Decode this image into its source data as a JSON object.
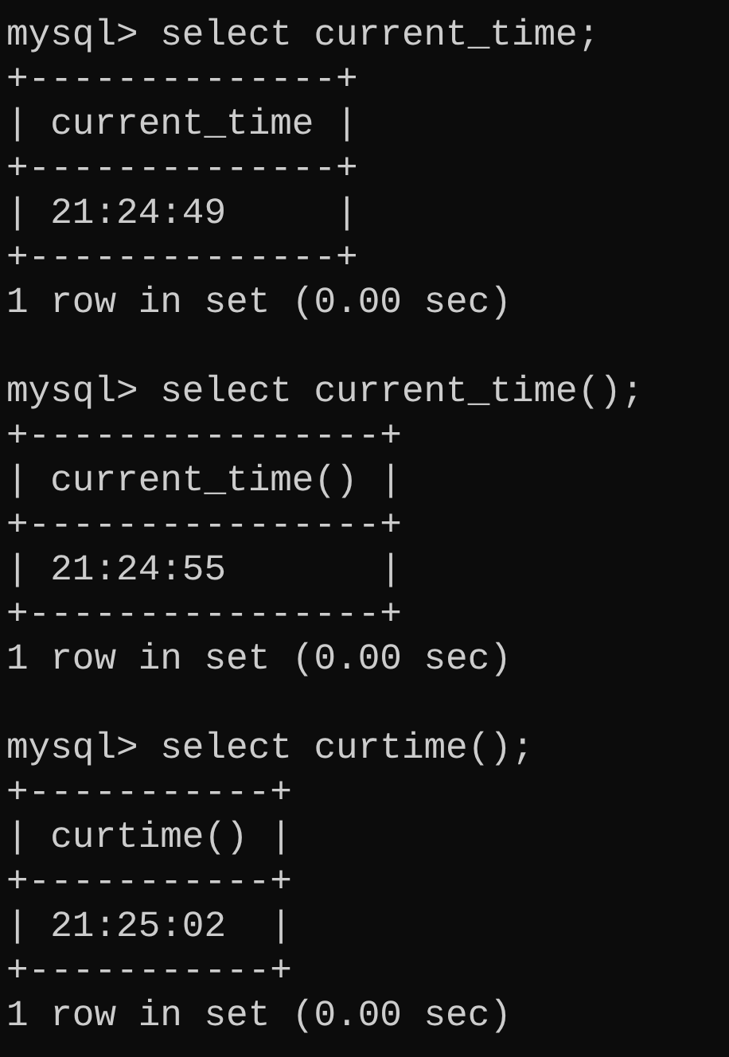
{
  "blocks": [
    {
      "command": "mysql> select current_time;",
      "table": {
        "top_border": "+--------------+",
        "header": "| current_time |",
        "header_border": "+--------------+",
        "row": "| 21:24:49     |",
        "bottom_border": "+--------------+"
      },
      "summary": "1 row in set (0.00 sec)"
    },
    {
      "command": "mysql> select current_time();",
      "table": {
        "top_border": "+----------------+",
        "header": "| current_time() |",
        "header_border": "+----------------+",
        "row": "| 21:24:55       |",
        "bottom_border": "+----------------+"
      },
      "summary": "1 row in set (0.00 sec)"
    },
    {
      "command": "mysql> select curtime();",
      "table": {
        "top_border": "+-----------+",
        "header": "| curtime() |",
        "header_border": "+-----------+",
        "row": "| 21:25:02  |",
        "bottom_border": "+-----------+"
      },
      "summary": "1 row in set (0.00 sec)"
    }
  ]
}
